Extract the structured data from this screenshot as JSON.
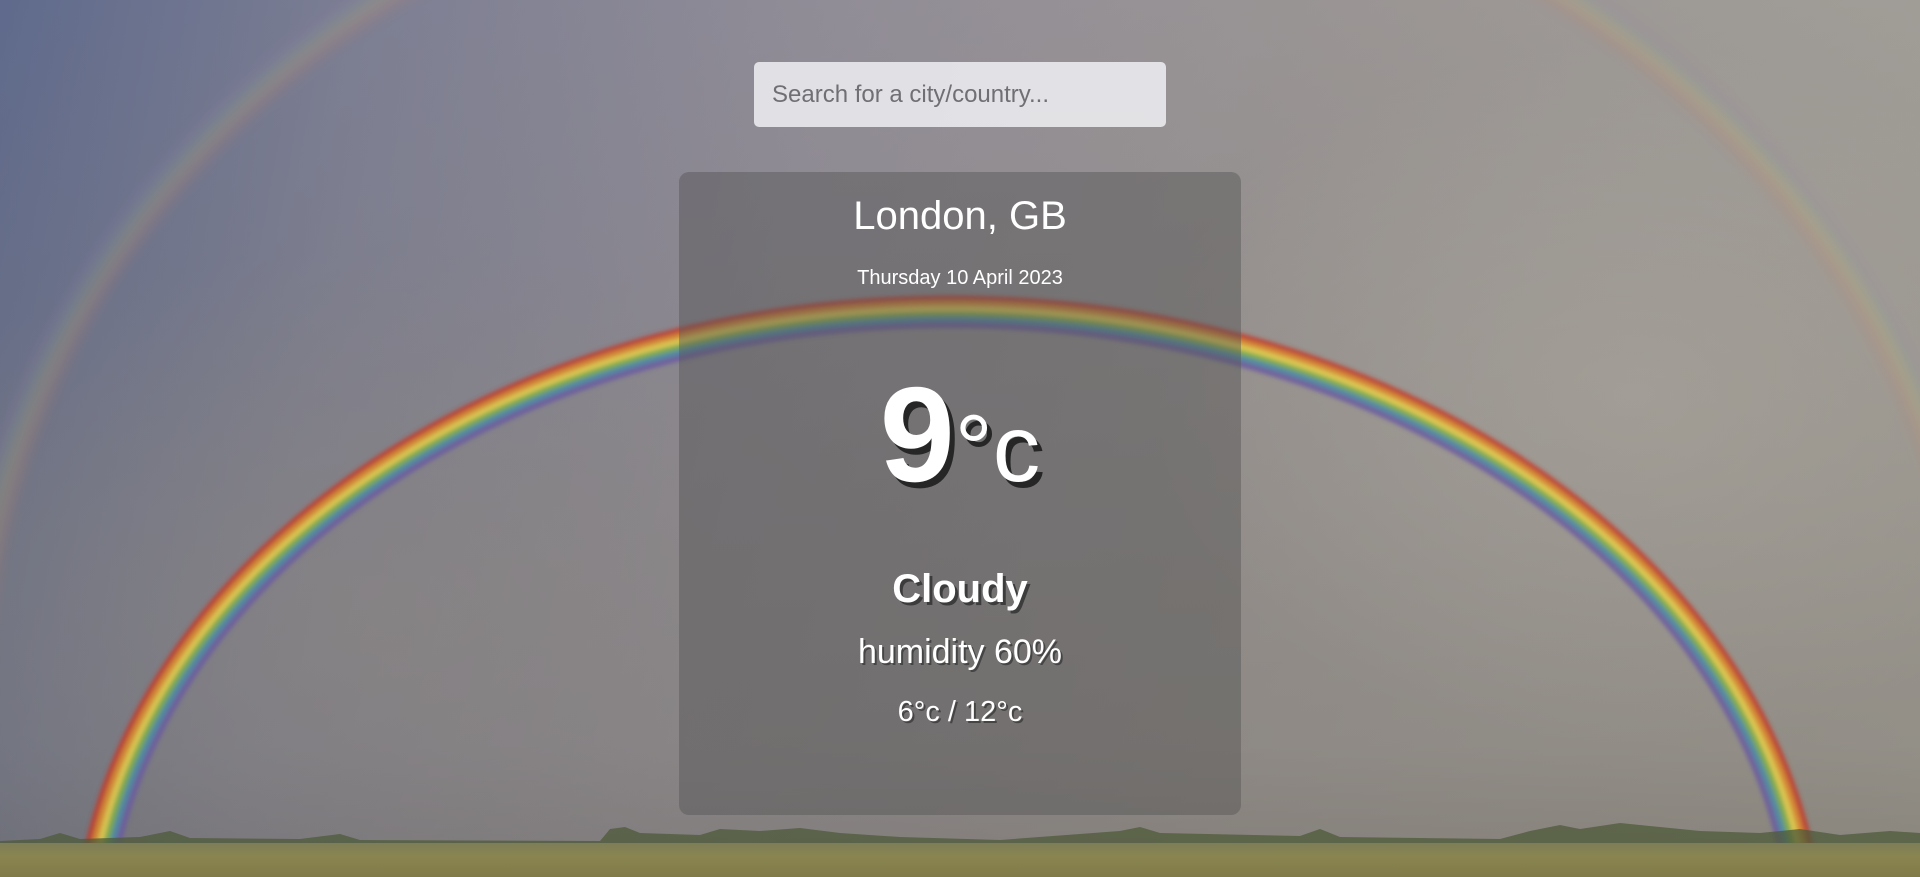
{
  "search": {
    "placeholder": "Search for a city/country...",
    "value": ""
  },
  "weather": {
    "location": "London, GB",
    "date": "Thursday 10 April 2023",
    "temperature": "9",
    "temperature_unit": "°c",
    "condition": "Cloudy",
    "humidity": "humidity 60%",
    "min_max": "6°c / 12°c"
  },
  "background": {
    "subject": "rainbow over a field",
    "sky_color": "#8f8c96",
    "card_color": "#555555"
  }
}
